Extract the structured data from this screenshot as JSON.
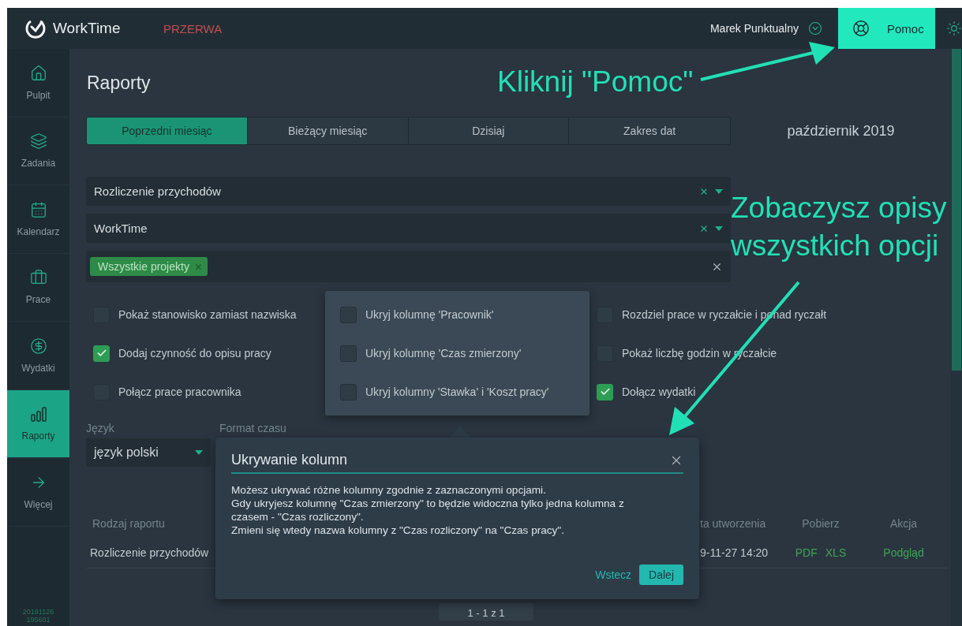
{
  "topbar": {
    "logo": "WorkTime",
    "status": "PRZERWA",
    "user": "Marek Punktualny",
    "help_button": "Pomoc"
  },
  "sidebar": {
    "items": [
      {
        "label": "Pulpit",
        "selected": false
      },
      {
        "label": "Zadania",
        "selected": false
      },
      {
        "label": "Kalendarz",
        "selected": false
      },
      {
        "label": "Prace",
        "selected": false
      },
      {
        "label": "Wydatki",
        "selected": false
      },
      {
        "label": "Raporty",
        "selected": true
      },
      {
        "label": "Więcej",
        "selected": false
      }
    ],
    "version": [
      "20191126",
      "195601"
    ]
  },
  "page_title": "Raporty",
  "period_tabs": [
    {
      "label": "Poprzedni miesiąc",
      "selected": true
    },
    {
      "label": "Bieżący miesiąc",
      "selected": false
    },
    {
      "label": "Dzisiaj",
      "selected": false
    },
    {
      "label": "Zakres dat",
      "selected": false
    }
  ],
  "period_label": "październik 2019",
  "filters": [
    {
      "kind": "select",
      "value": "Rozliczenie przychodów"
    },
    {
      "kind": "select",
      "value": "WorkTime"
    },
    {
      "kind": "tags",
      "tags": [
        "Wszystkie projekty"
      ]
    }
  ],
  "options": {
    "left": [
      {
        "label": "Pokaż stanowisko zamiast nazwiska",
        "checked": false
      },
      {
        "label": "Dodaj czynność do opisu pracy",
        "checked": true
      },
      {
        "label": "Połącz prace pracownika",
        "checked": false
      }
    ],
    "popup": [
      {
        "label": "Ukryj kolumnę 'Pracownik'",
        "checked": false
      },
      {
        "label": "Ukryj kolumnę 'Czas zmierzony'",
        "checked": false
      },
      {
        "label": "Ukryj kolumny 'Stawka' i 'Koszt pracy'",
        "checked": false
      }
    ],
    "right": [
      {
        "label": "Rozdziel prace w ryczałcie i ponad ryczałt",
        "checked": false
      },
      {
        "label": "Pokaż liczbę godzin w ryczałcie",
        "checked": false
      },
      {
        "label": "Dołącz wydatki",
        "checked": true
      }
    ]
  },
  "language": {
    "label": "Język",
    "value": "język polski"
  },
  "time_format": {
    "label": "Format czasu"
  },
  "table": {
    "columns": [
      "Rodzaj raportu",
      "ta utworzenia",
      "Pobierz",
      "Akcja"
    ],
    "rows": [
      {
        "type": "Rozliczenie przychodów",
        "created": "9-11-27 14:20",
        "downloads": [
          "PDF",
          "XLS"
        ],
        "action": "Podgląd"
      }
    ]
  },
  "pagination": "1 - 1 z 1",
  "tour_dialog": {
    "title": "Ukrywanie kolumn",
    "lines": [
      "Możesz ukrywać różne kolumny zgodnie z zaznaczonymi opcjami.",
      "Gdy ukryjesz kolumnę \"Czas zmierzony\" to będzie widoczna tylko jedna kolumna z czasem - \"Czas rozliczony\".",
      "Zmieni się wtedy nazwa kolumny z \"Czas rozliczony\" na \"Czas pracy\"."
    ],
    "back": "Wstecz",
    "next": "Dalej"
  },
  "annotations": [
    "Kliknij \"Pomoc\"",
    "Zobaczysz opisy wszystkich opcji"
  ]
}
